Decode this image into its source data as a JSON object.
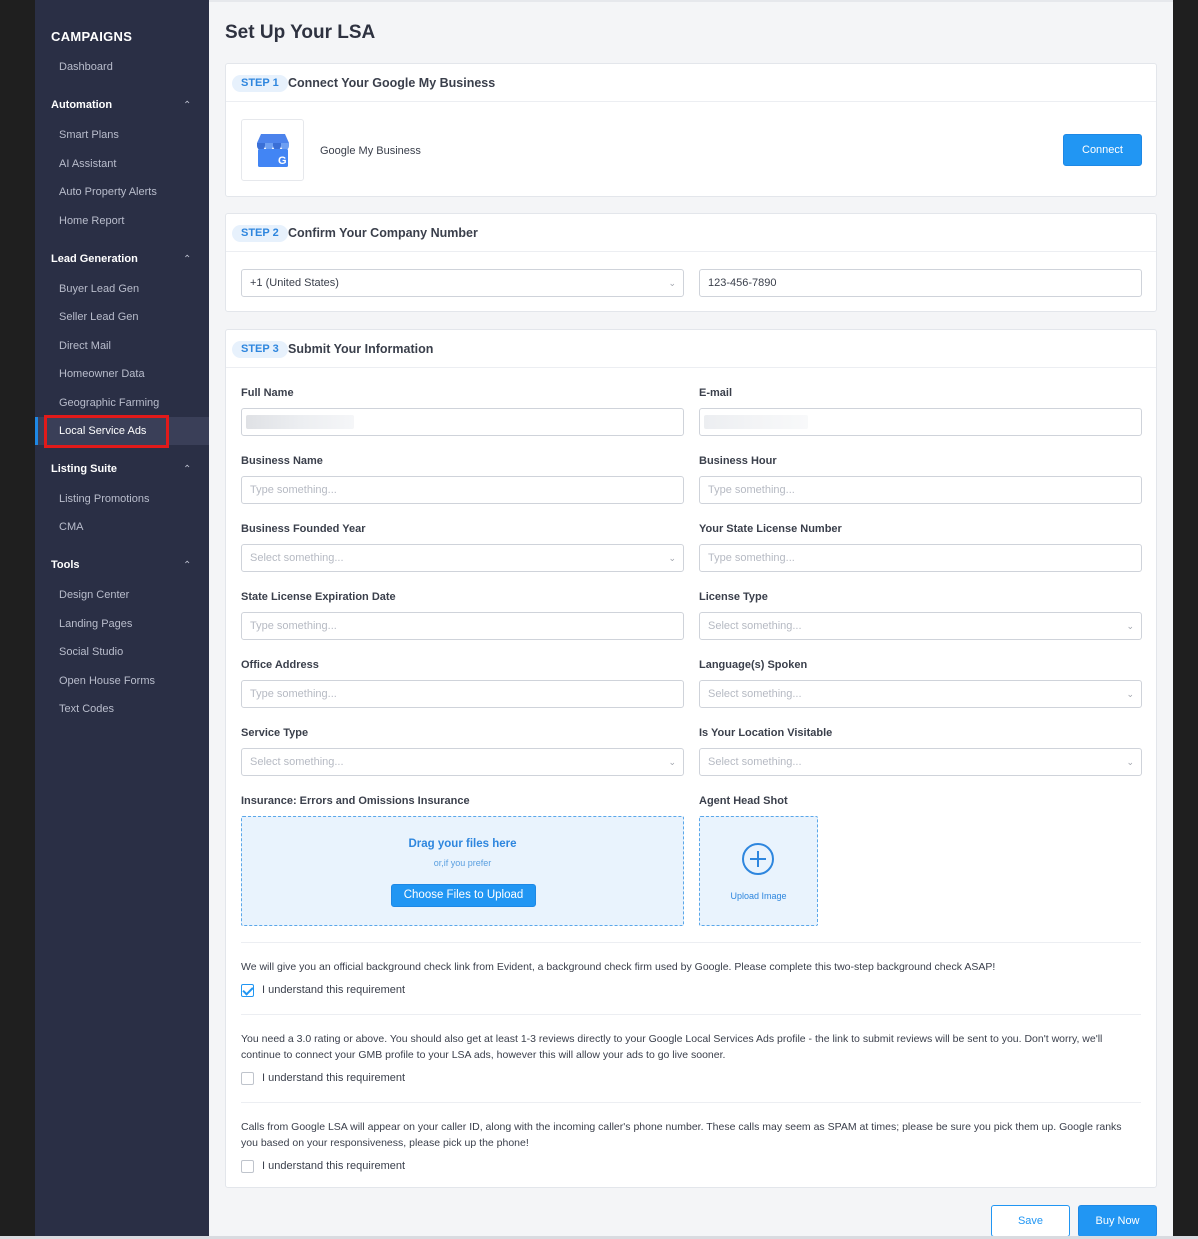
{
  "sidebar": {
    "title": "CAMPAIGNS",
    "dashboard": "Dashboard",
    "groups": [
      {
        "label": "Automation",
        "items": [
          "Smart Plans",
          "AI Assistant",
          "Auto Property Alerts",
          "Home Report"
        ]
      },
      {
        "label": "Lead Generation",
        "items": [
          "Buyer Lead Gen",
          "Seller Lead Gen",
          "Direct Mail",
          "Homeowner Data",
          "Geographic Farming",
          "Local Service Ads"
        ]
      },
      {
        "label": "Listing Suite",
        "items": [
          "Listing Promotions",
          "CMA"
        ]
      },
      {
        "label": "Tools",
        "items": [
          "Design Center",
          "Landing Pages",
          "Social Studio",
          "Open House Forms",
          "Text Codes"
        ]
      }
    ],
    "active_item": "Local Service Ads",
    "chevron": "^"
  },
  "page": {
    "title": "Set Up Your LSA"
  },
  "step1": {
    "badge": "STEP 1",
    "title": "Connect Your Google My Business",
    "service_name": "Google My Business",
    "icon": "gmb-store-icon",
    "connect_label": "Connect"
  },
  "step2": {
    "badge": "STEP 2",
    "title": "Confirm Your Company Number",
    "country_value": "+1 (United States)",
    "phone_value": "123-456-7890"
  },
  "step3": {
    "badge": "STEP 3",
    "title": "Submit Your Information",
    "fields": {
      "full_name": "Full Name",
      "email": "E-mail",
      "business_name": "Business Name",
      "business_hour": "Business Hour",
      "founded_year": "Business Founded Year",
      "state_license_number": "Your State License Number",
      "license_expiration": "State License Expiration Date",
      "license_type": "License Type",
      "office_address": "Office Address",
      "languages": "Language(s) Spoken",
      "service_type": "Service Type",
      "location_visitable": "Is Your Location Visitable",
      "insurance": "Insurance: Errors and Omissions Insurance",
      "head_shot": "Agent Head Shot"
    },
    "placeholder_type": "Type something...",
    "placeholder_select": "Select something...",
    "dropzone": {
      "title": "Drag your files here",
      "subtitle": "or,if you prefer",
      "button": "Choose Files to Upload"
    },
    "upload_image_label": "Upload Image",
    "requirements": [
      {
        "text": "We will give you an official background check link from Evident, a background check firm used by Google. Please complete this two-step background check ASAP!",
        "checkbox_label": "I understand this requirement",
        "checked": true
      },
      {
        "text": "You need a 3.0 rating or above. You should also get at least 1-3 reviews directly to your Google Local Services Ads profile - the link to submit reviews will be sent to you. Don't worry, we'll continue to connect your GMB profile to your LSA ads, however this will allow your ads to go live sooner.",
        "checkbox_label": "I understand this requirement",
        "checked": false
      },
      {
        "text": "Calls from Google LSA will appear on your caller ID, along with the incoming caller's phone number. These calls may seem as SPAM at times; please be sure you pick them up. Google ranks you based on your responsiveness, please pick up the phone!",
        "checkbox_label": "I understand this requirement",
        "checked": false
      }
    ]
  },
  "footer": {
    "save_label": "Save",
    "buy_label": "Buy Now"
  },
  "colors": {
    "accent": "#2196f3",
    "sidebar_bg": "#2a2f45",
    "highlight": "#e11a1a"
  }
}
